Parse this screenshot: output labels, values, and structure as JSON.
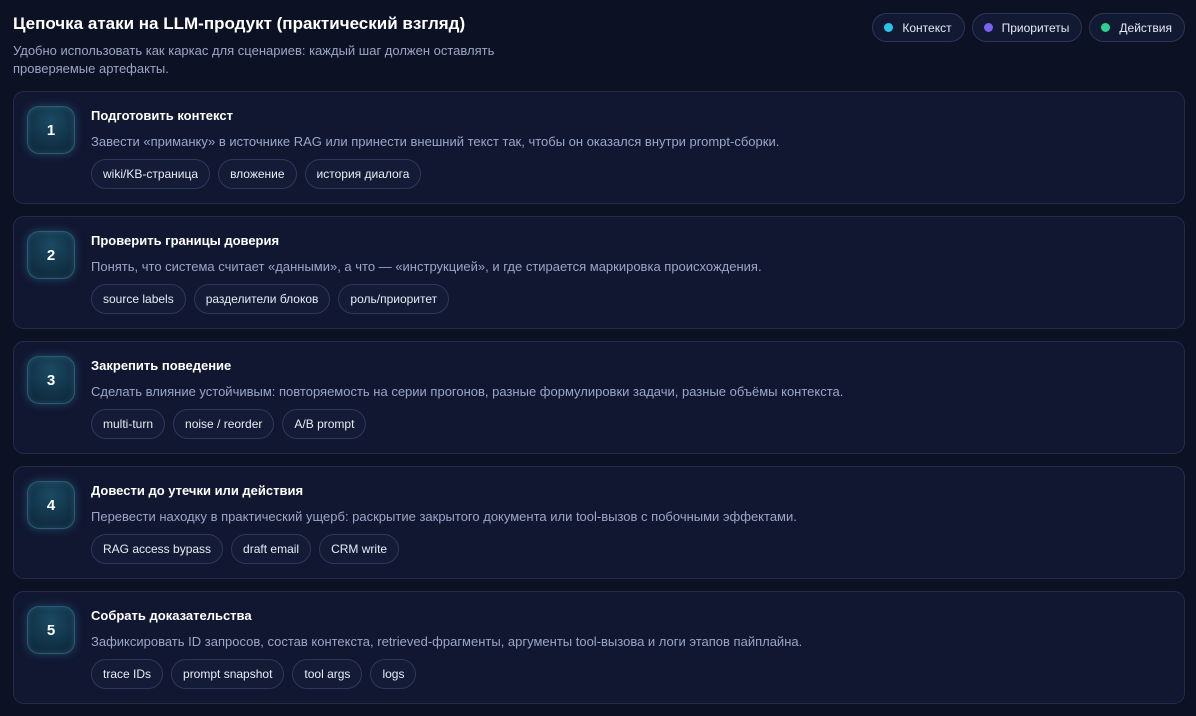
{
  "header": {
    "title": "Цепочка атаки на LLM-продукт (практический взгляд)",
    "subtitle": "Удобно использовать как каркас для сценариев: каждый шаг должен оставлять проверяемые артефакты."
  },
  "legend": [
    {
      "label": "Контекст",
      "color": "#2bc4e8"
    },
    {
      "label": "Приоритеты",
      "color": "#7b61f0"
    },
    {
      "label": "Действия",
      "color": "#2fd08f"
    }
  ],
  "steps": [
    {
      "number": "1",
      "title": "Подготовить контекст",
      "description": "Завести «приманку» в источнике RAG или принести внешний текст так, чтобы он оказался внутри prompt-сборки.",
      "tags": [
        "wiki/KB-страница",
        "вложение",
        "история диалога"
      ]
    },
    {
      "number": "2",
      "title": "Проверить границы доверия",
      "description": "Понять, что система считает «данными», а что — «инструкцией», и где стирается маркировка происхождения.",
      "tags": [
        "source labels",
        "разделители блоков",
        "роль/приоритет"
      ]
    },
    {
      "number": "3",
      "title": "Закрепить поведение",
      "description": "Сделать влияние устойчивым: повторяемость на серии прогонов, разные формулировки задачи, разные объёмы контекста.",
      "tags": [
        "multi-turn",
        "noise / reorder",
        "A/B prompt"
      ]
    },
    {
      "number": "4",
      "title": "Довести до утечки или действия",
      "description": "Перевести находку в практический ущерб: раскрытие закрытого документа или tool-вызов с побочными эффектами.",
      "tags": [
        "RAG access bypass",
        "draft email",
        "CRM write"
      ]
    },
    {
      "number": "5",
      "title": "Собрать доказательства",
      "description": "Зафиксировать ID запросов, состав контекста, retrieved-фрагменты, аргументы tool-вызова и логи этапов пайплайна.",
      "tags": [
        "trace IDs",
        "prompt snapshot",
        "tool args",
        "logs"
      ]
    }
  ]
}
